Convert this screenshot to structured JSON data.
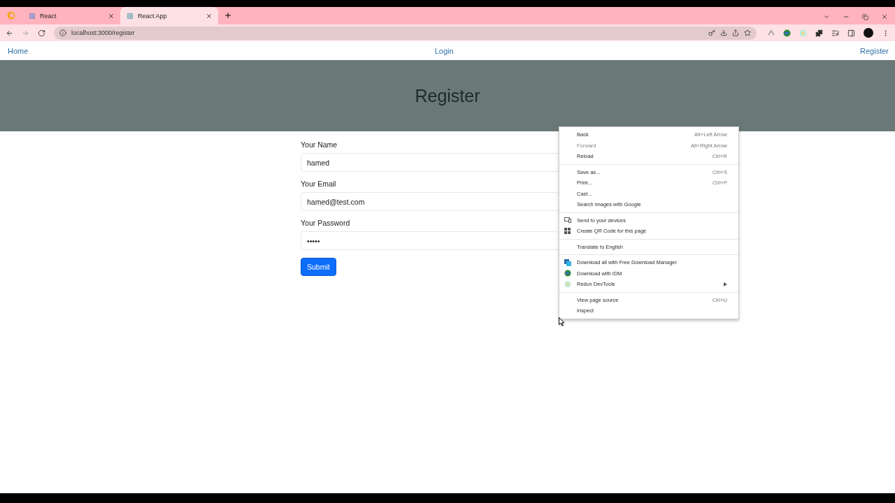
{
  "browser": {
    "tabs": [
      {
        "title": "React",
        "selected": false
      },
      {
        "title": "React App",
        "selected": true
      }
    ],
    "address": "localhost:3000/register"
  },
  "nav": {
    "links": [
      {
        "label": "Home"
      },
      {
        "label": "Login"
      },
      {
        "label": "Register"
      }
    ]
  },
  "header": {
    "title": "Register"
  },
  "form": {
    "fields": [
      {
        "label": "Your Name",
        "value": "hamed"
      },
      {
        "label": "Your Email",
        "value": "hamed@test.com"
      },
      {
        "label": "Your Password",
        "value": "•••••"
      }
    ],
    "submit": "Submit"
  },
  "context_menu": {
    "items": [
      {
        "kind": "item",
        "label": "Back",
        "shortcut": "Alt+Left Arrow",
        "disabled": false
      },
      {
        "kind": "item",
        "label": "Forward",
        "shortcut": "Alt+Right Arrow",
        "disabled": true
      },
      {
        "kind": "item",
        "label": "Reload",
        "shortcut": "Ctrl+R",
        "disabled": false
      },
      {
        "kind": "separator"
      },
      {
        "kind": "item",
        "label": "Save as...",
        "shortcut": "Ctrl+S",
        "disabled": false
      },
      {
        "kind": "item",
        "label": "Print...",
        "shortcut": "Ctrl+P",
        "disabled": false
      },
      {
        "kind": "item",
        "label": "Cast...",
        "disabled": false
      },
      {
        "kind": "item",
        "label": "Search images with Google",
        "disabled": false
      },
      {
        "kind": "separator"
      },
      {
        "kind": "icon-item",
        "label": "Send to your devices",
        "disabled": false
      },
      {
        "kind": "icon-item",
        "label": "Create QR Code for this page",
        "disabled": false
      },
      {
        "kind": "separator"
      },
      {
        "kind": "item",
        "label": "Translate to English",
        "disabled": false
      },
      {
        "kind": "separator"
      },
      {
        "kind": "icon-item",
        "label": "Download all with Free Download Manager",
        "disabled": false
      },
      {
        "kind": "icon-item",
        "label": "Download with IDM",
        "disabled": false
      },
      {
        "kind": "icon-item",
        "label": "Redux DevTools",
        "submenu": true,
        "disabled": false
      },
      {
        "kind": "separator"
      },
      {
        "kind": "item",
        "label": "View page source",
        "shortcut": "Ctrl+U",
        "disabled": false
      },
      {
        "kind": "item",
        "label": "Inspect",
        "disabled": false
      }
    ]
  }
}
